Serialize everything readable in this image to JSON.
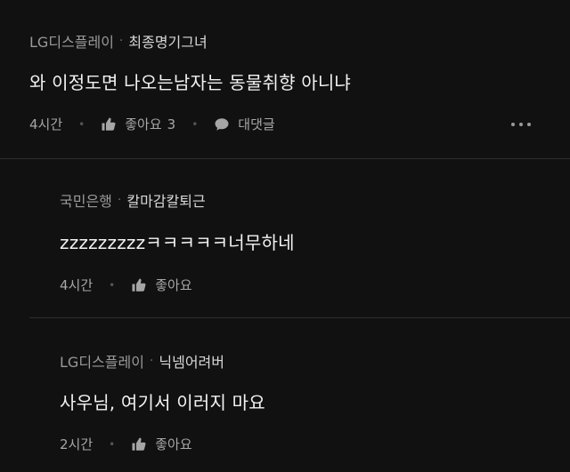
{
  "comments": [
    {
      "org": "LG디스플레이",
      "separator": "·",
      "nickname": "최종명기그녀",
      "text": "와 이정도면 나오는남자는 동물취향 아니냐",
      "time": "4시간",
      "like_label": "좋아요",
      "like_count": "3",
      "reply_label": "대댓글"
    }
  ],
  "replies": [
    {
      "org": "국민은행",
      "separator": "·",
      "nickname": "칼마감칼퇴근",
      "text": "zzzzzzzzzㅋㅋㅋㅋㅋ너무하네",
      "time": "4시간",
      "like_label": "좋아요"
    },
    {
      "org": "LG디스플레이",
      "separator": "·",
      "nickname": "닉넴어려버",
      "text": "사우님, 여기서 이러지 마요",
      "time": "2시간",
      "like_label": "좋아요"
    }
  ],
  "icons": {
    "like": "thumbs-up-icon",
    "reply": "speech-bubble-icon",
    "more": "more-horizontal-icon"
  },
  "colors": {
    "background": "#111111",
    "text": "#f2f2f2",
    "muted": "#9a9a9a",
    "divider": "#2e2e2e"
  }
}
